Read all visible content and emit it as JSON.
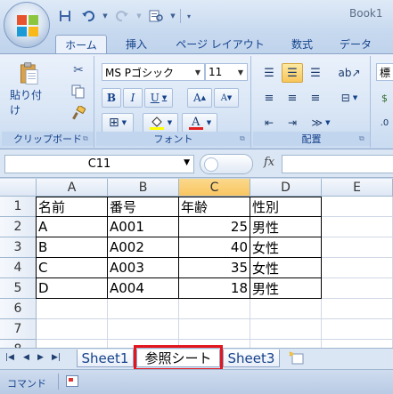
{
  "window": {
    "title": "Book1"
  },
  "qat": {
    "save_icon": "save-icon",
    "undo_icon": "undo-icon",
    "redo_icon": "redo-icon",
    "print_preview_icon": "print-preview-icon"
  },
  "tabs": [
    {
      "label": "ホーム",
      "active": true
    },
    {
      "label": "挿入"
    },
    {
      "label": "ページ レイアウト"
    },
    {
      "label": "数式"
    },
    {
      "label": "データ"
    }
  ],
  "ribbon": {
    "clipboard": {
      "label": "クリップボード",
      "paste_label": "貼り付け"
    },
    "font": {
      "label": "フォント",
      "font_name": "MS Pゴシック",
      "font_size": "11",
      "bold": "B",
      "italic": "I",
      "underline": "U",
      "grow": "A",
      "shrink": "A"
    },
    "alignment": {
      "label": "配置"
    },
    "number": {
      "label_partial": "標"
    }
  },
  "formula_bar": {
    "name_box": "C11",
    "fx_label": "fx",
    "formula": ""
  },
  "columns": [
    "A",
    "B",
    "C",
    "D",
    "E"
  ],
  "selected_column": "C",
  "rows": [
    "1",
    "2",
    "3",
    "4",
    "5",
    "6",
    "7",
    "8"
  ],
  "cells": {
    "header": [
      "名前",
      "番号",
      "年齢",
      "性別"
    ],
    "data": [
      [
        "A",
        "A001",
        "25",
        "男性"
      ],
      [
        "B",
        "A002",
        "40",
        "女性"
      ],
      [
        "C",
        "A003",
        "35",
        "女性"
      ],
      [
        "D",
        "A004",
        "18",
        "男性"
      ]
    ]
  },
  "sheets": [
    {
      "label": "Sheet1"
    },
    {
      "label": "参照シート",
      "active": true,
      "highlighted": true
    },
    {
      "label": "Sheet3"
    }
  ],
  "status": {
    "mode": "コマンド"
  },
  "colors": {
    "highlight_border": "#e3151d",
    "selected_column_header": "#f9c561",
    "ribbon_text": "#15428b"
  }
}
